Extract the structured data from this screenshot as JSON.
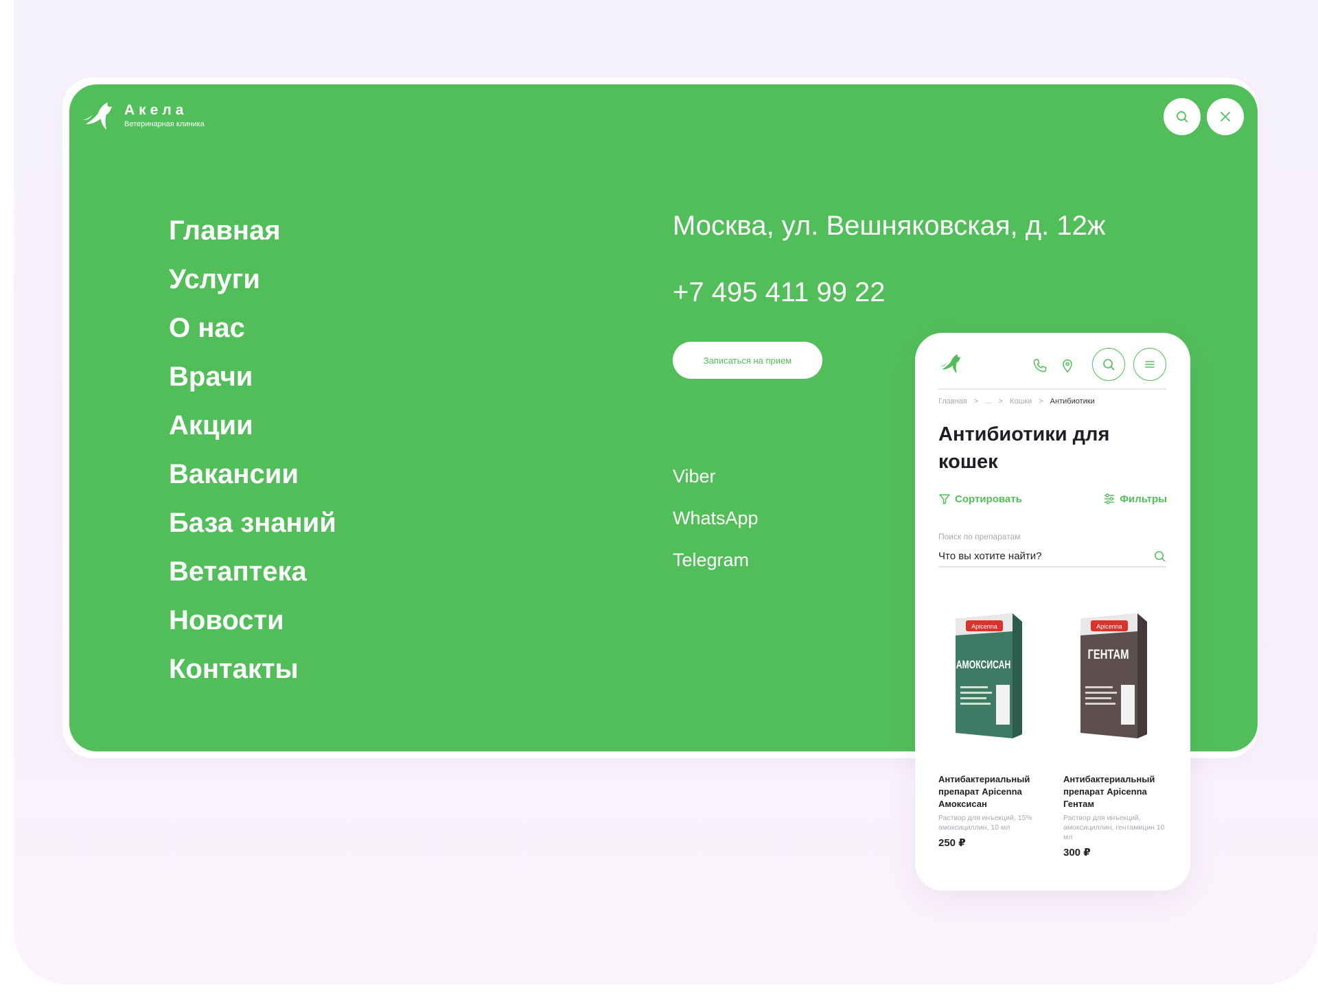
{
  "brand": {
    "name": "Акела",
    "subtitle": "Ветеринарная клиника",
    "accent_color": "#52be5a"
  },
  "header": {
    "search_icon": "search-icon",
    "close_icon": "close-icon"
  },
  "nav": {
    "items": [
      {
        "label": "Главная"
      },
      {
        "label": "Услуги"
      },
      {
        "label": "О нас"
      },
      {
        "label": "Врачи"
      },
      {
        "label": "Акции"
      },
      {
        "label": "Вакансии"
      },
      {
        "label": "База знаний"
      },
      {
        "label": "Ветаптека"
      },
      {
        "label": "Новости"
      },
      {
        "label": "Контакты"
      }
    ]
  },
  "contacts": {
    "address": "Москва, ул. Вешняковская, д. 12ж",
    "phone": "+7 495 411 99 22",
    "book_button": "Записаться на прием",
    "messengers": [
      "Viber",
      "WhatsApp",
      "Telegram"
    ]
  },
  "mobile": {
    "header_icons": [
      "phone-icon",
      "location-icon",
      "search-icon",
      "menu-icon"
    ],
    "breadcrumbs": {
      "home": "Главная",
      "sep": ">",
      "ellipsis": "...",
      "cats": "Кошки",
      "current": "Антибиотики"
    },
    "title": "Антибиотики для кошек",
    "sort_label": "Сортировать",
    "filter_label": "Фильтры",
    "search": {
      "label": "Поиск по препаратам",
      "placeholder": "Что вы хотите найти?"
    },
    "products": [
      {
        "name": "Антибактериальный препарат Apicenna Амоксисан",
        "description": "Раствор для инъекций, 15% амоксициллин, 10 мл",
        "price": "250 ₽",
        "pack_brand": "Apicenna",
        "pack_label": "АМОКСИСАН",
        "pack_color": "#3f7a64"
      },
      {
        "name": "Антибактериальный препарат Apicenna Гентам",
        "description": "Раствор для инъекций, амоксициллин, гентамицин 10 мл",
        "price": "300 ₽",
        "pack_brand": "Apicenna",
        "pack_label": "ГЕНТАМ",
        "pack_color": "#5c4f4e"
      }
    ]
  }
}
